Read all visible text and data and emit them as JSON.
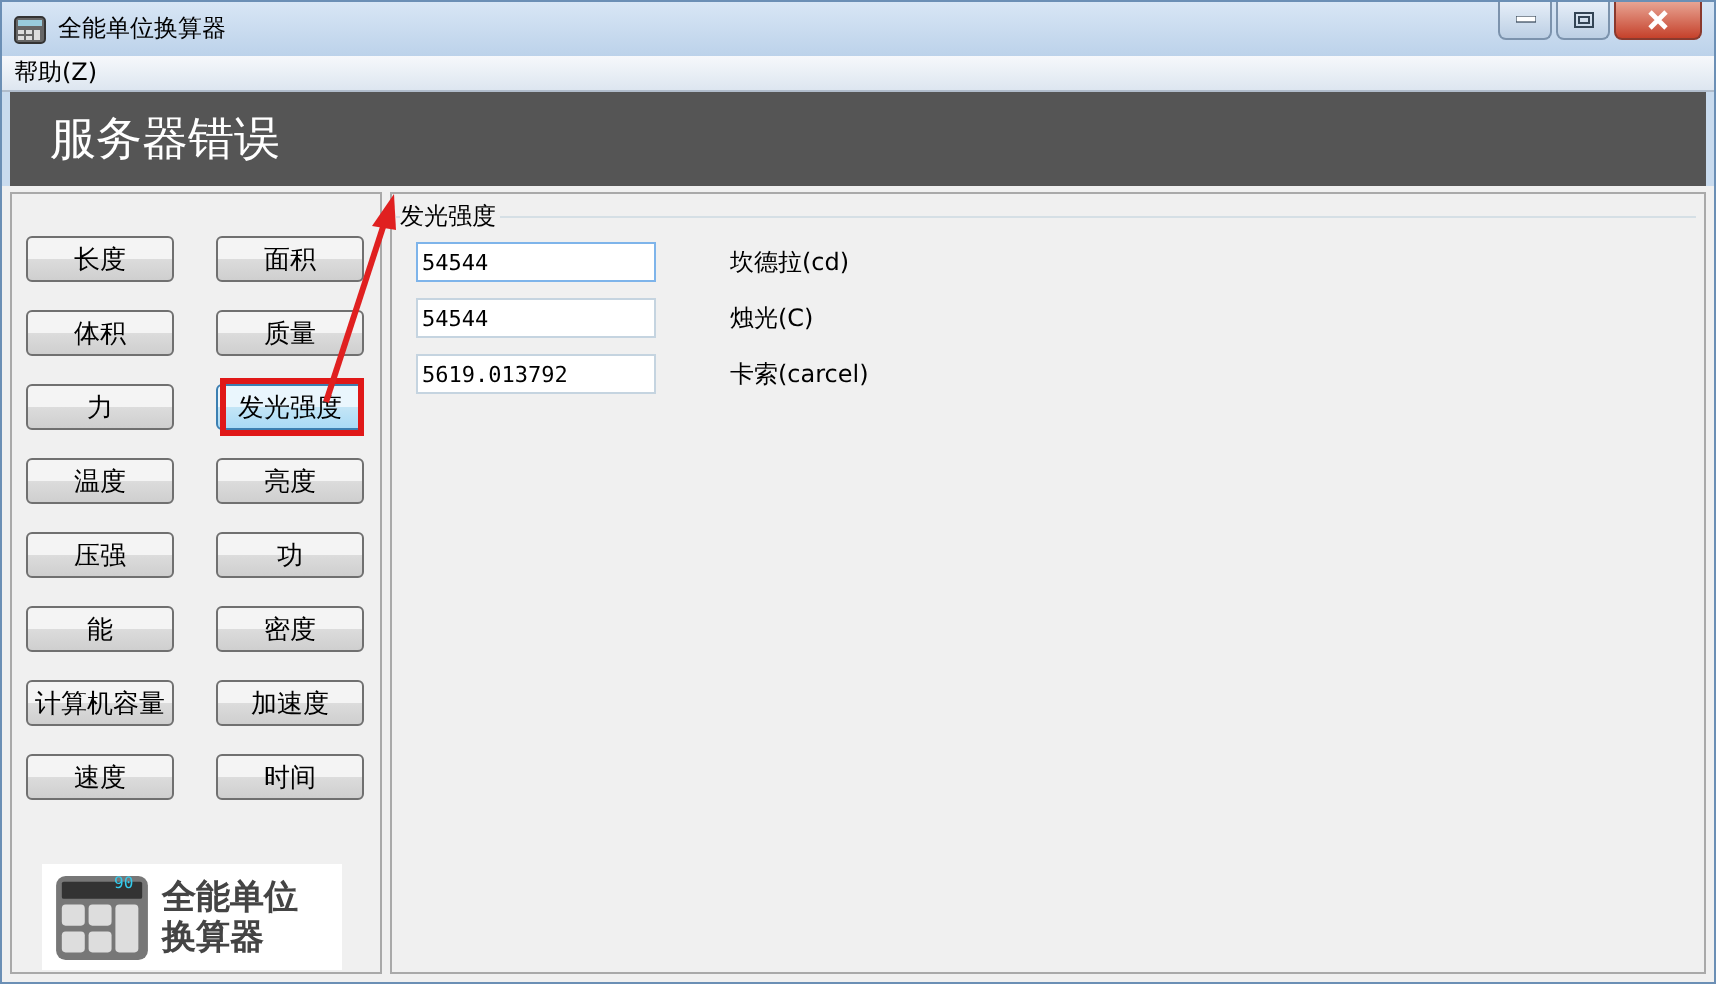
{
  "window": {
    "title": "全能单位换算器"
  },
  "menu": [
    {
      "label": "帮助(Z)"
    }
  ],
  "banner": {
    "text": "服务器错误"
  },
  "unit_buttons": [
    {
      "label": "长度",
      "selected": false
    },
    {
      "label": "面积",
      "selected": false
    },
    {
      "label": "体积",
      "selected": false
    },
    {
      "label": "质量",
      "selected": false
    },
    {
      "label": "力",
      "selected": false
    },
    {
      "label": "发光强度",
      "selected": true
    },
    {
      "label": "温度",
      "selected": false
    },
    {
      "label": "亮度",
      "selected": false
    },
    {
      "label": "压强",
      "selected": false
    },
    {
      "label": "功",
      "selected": false
    },
    {
      "label": "能",
      "selected": false
    },
    {
      "label": "密度",
      "selected": false
    },
    {
      "label": "计算机容量",
      "selected": false
    },
    {
      "label": "加速度",
      "selected": false
    },
    {
      "label": "速度",
      "selected": false
    },
    {
      "label": "时间",
      "selected": false
    }
  ],
  "logo": {
    "display": "90",
    "lines": [
      "全能单位",
      "换算器"
    ]
  },
  "group": {
    "title": "发光强度",
    "rows": [
      {
        "value": "54544",
        "unit": "坎德拉(cd)",
        "focused": true
      },
      {
        "value": "54544",
        "unit": "烛光(C)",
        "focused": false
      },
      {
        "value": "5619.013792",
        "unit": "卡索(carcel)",
        "focused": false
      }
    ]
  }
}
